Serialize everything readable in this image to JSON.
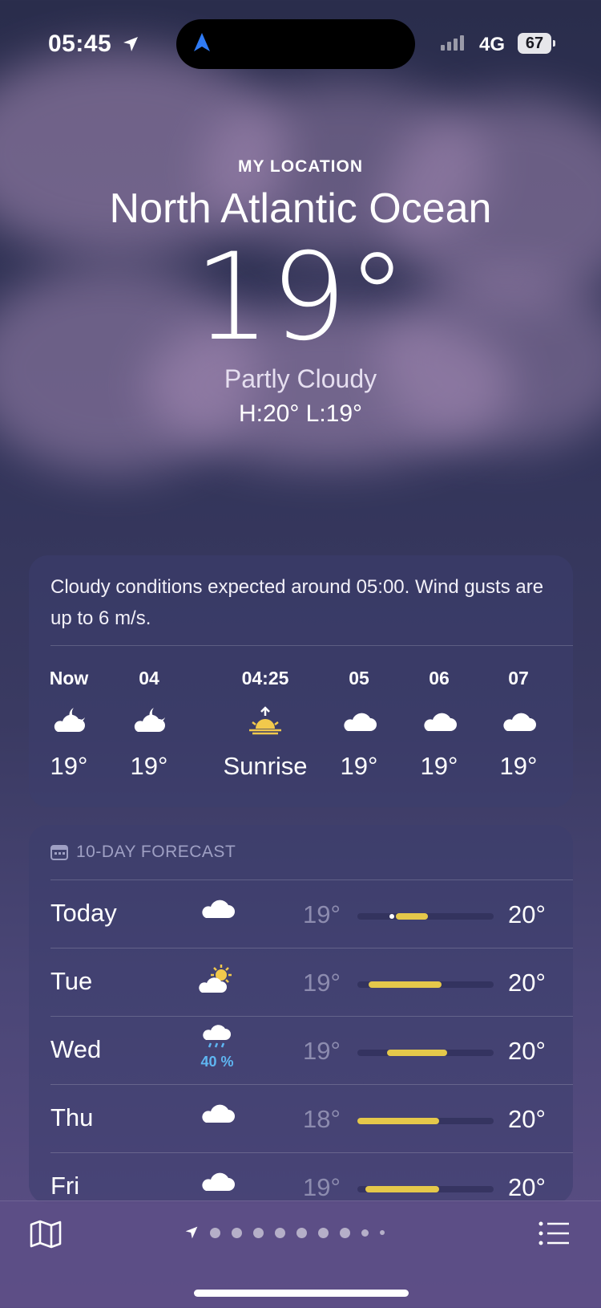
{
  "status": {
    "time": "05:45",
    "network": "4G",
    "battery": "67"
  },
  "location": {
    "label": "MY LOCATION",
    "name": "North Atlantic Ocean",
    "temperature": "19°",
    "condition": "Partly Cloudy",
    "hilo": "H:20°  L:19°"
  },
  "hourly": {
    "summary": "Cloudy conditions expected around 05:00. Wind gusts are up to 6 m/s.",
    "items": [
      {
        "label": "Now",
        "icon": "partly-cloudy-night-icon",
        "temp": "19°"
      },
      {
        "label": "04",
        "icon": "partly-cloudy-night-icon",
        "temp": "19°"
      },
      {
        "label": "04:25",
        "icon": "sunrise-icon",
        "temp": "Sunrise"
      },
      {
        "label": "05",
        "icon": "cloud-icon",
        "temp": "19°"
      },
      {
        "label": "06",
        "icon": "cloud-icon",
        "temp": "19°"
      },
      {
        "label": "07",
        "icon": "cloud-icon",
        "temp": "19°"
      }
    ]
  },
  "forecast": {
    "title": "10-DAY FORECAST",
    "rows": [
      {
        "day": "Today",
        "icon": "cloud-icon",
        "precip": "",
        "low": "19°",
        "high": "20°",
        "bar_start": 0.28,
        "bar_end": 0.52,
        "current": 0.25
      },
      {
        "day": "Tue",
        "icon": "partly-sunny-icon",
        "precip": "",
        "low": "19°",
        "high": "20°",
        "bar_start": 0.08,
        "bar_end": 0.62
      },
      {
        "day": "Wed",
        "icon": "rain-cloud-icon",
        "precip": "40 %",
        "low": "19°",
        "high": "20°",
        "bar_start": 0.22,
        "bar_end": 0.66
      },
      {
        "day": "Thu",
        "icon": "cloud-icon",
        "precip": "",
        "low": "18°",
        "high": "20°",
        "bar_start": 0.0,
        "bar_end": 0.6
      },
      {
        "day": "Fri",
        "icon": "cloud-icon",
        "precip": "",
        "low": "19°",
        "high": "20°",
        "bar_start": 0.06,
        "bar_end": 0.6
      }
    ]
  },
  "colors": {
    "accent_bar": "#e5c84a",
    "precip": "#5fb6f2",
    "low_temp": "#8d8caf"
  },
  "tabbar": {
    "pages": 9
  }
}
